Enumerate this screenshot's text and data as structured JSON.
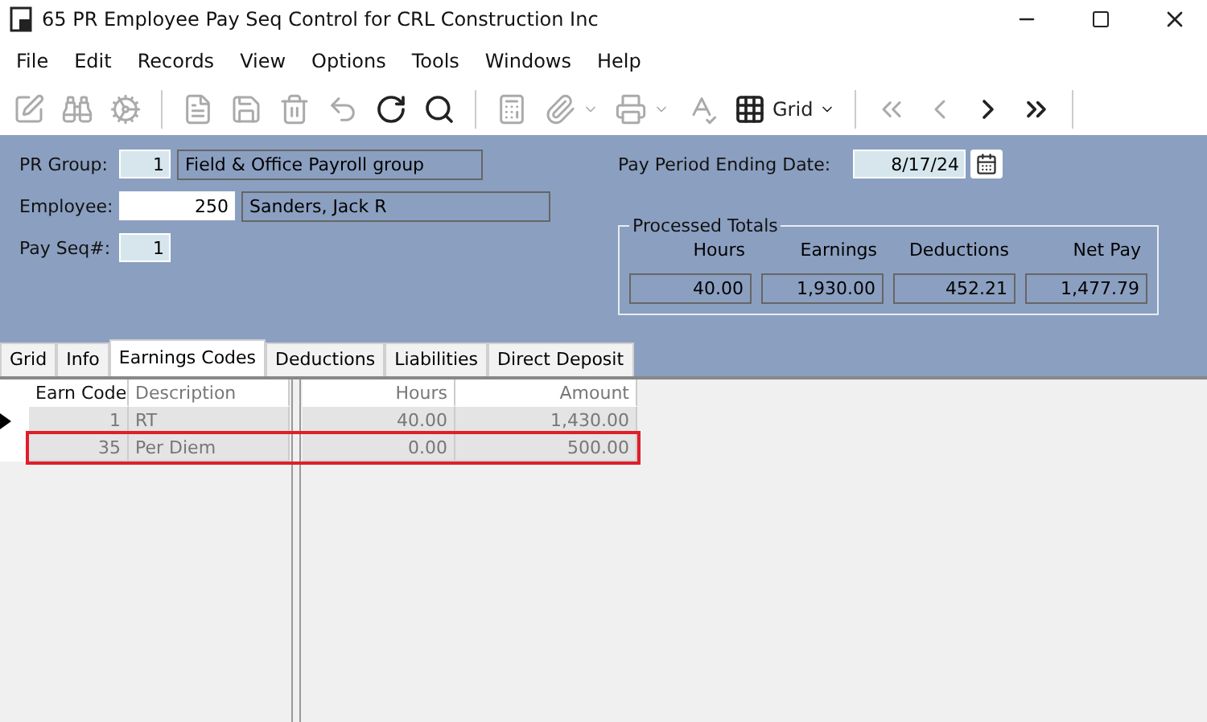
{
  "window": {
    "title": "65 PR Employee Pay Seq Control for CRL Construction Inc"
  },
  "menu": [
    "File",
    "Edit",
    "Records",
    "View",
    "Options",
    "Tools",
    "Windows",
    "Help"
  ],
  "toolbar": [
    {
      "kind": "edit",
      "disabled": true
    },
    {
      "kind": "find",
      "disabled": true
    },
    {
      "kind": "gear",
      "disabled": true
    },
    {
      "kind": "sep"
    },
    {
      "kind": "new",
      "disabled": true
    },
    {
      "kind": "save",
      "disabled": true
    },
    {
      "kind": "delete",
      "disabled": true
    },
    {
      "kind": "undo",
      "disabled": true
    },
    {
      "kind": "refresh",
      "disabled": false
    },
    {
      "kind": "search",
      "disabled": false
    },
    {
      "kind": "sep"
    },
    {
      "kind": "calc",
      "disabled": true
    },
    {
      "kind": "attach",
      "disabled": true
    },
    {
      "kind": "print",
      "disabled": true
    },
    {
      "kind": "spell",
      "disabled": true
    },
    {
      "kind": "grid",
      "disabled": false,
      "label": "Grid"
    },
    {
      "kind": "sep"
    },
    {
      "kind": "first",
      "disabled": true
    },
    {
      "kind": "prev",
      "disabled": true
    },
    {
      "kind": "next",
      "disabled": false
    },
    {
      "kind": "last",
      "disabled": false
    },
    {
      "kind": "sep"
    }
  ],
  "header": {
    "pr_group": {
      "label": "PR Group:",
      "value": "1",
      "description": "Field & Office Payroll group"
    },
    "employee": {
      "label": "Employee:",
      "value": "250",
      "description": "Sanders, Jack R"
    },
    "pay_seq": {
      "label": "Pay Seq#:",
      "value": "1"
    },
    "pay_period": {
      "label": "Pay Period Ending Date:",
      "value": "8/17/24"
    },
    "processed_totals": {
      "title": "Processed Totals",
      "items": [
        {
          "label": "Hours",
          "value": "40.00"
        },
        {
          "label": "Earnings",
          "value": "1,930.00"
        },
        {
          "label": "Deductions",
          "value": "452.21"
        },
        {
          "label": "Net Pay",
          "value": "1,477.79"
        }
      ]
    }
  },
  "tabs": [
    {
      "label": "Grid",
      "selected": false
    },
    {
      "label": "Info",
      "selected": false
    },
    {
      "label": "Earnings Codes",
      "selected": true
    },
    {
      "label": "Deductions",
      "selected": false
    },
    {
      "label": "Liabilities",
      "selected": false
    },
    {
      "label": "Direct Deposit",
      "selected": false
    }
  ],
  "grid": {
    "columns": [
      "Earn Code",
      "Description",
      "Hours",
      "Amount"
    ],
    "rows": [
      {
        "cells": [
          "1",
          "RT",
          "40.00",
          "1,430.00"
        ],
        "current": true,
        "highlighted": false
      },
      {
        "cells": [
          "35",
          "Per Diem",
          "0.00",
          "500.00"
        ],
        "current": false,
        "highlighted": true
      }
    ]
  }
}
